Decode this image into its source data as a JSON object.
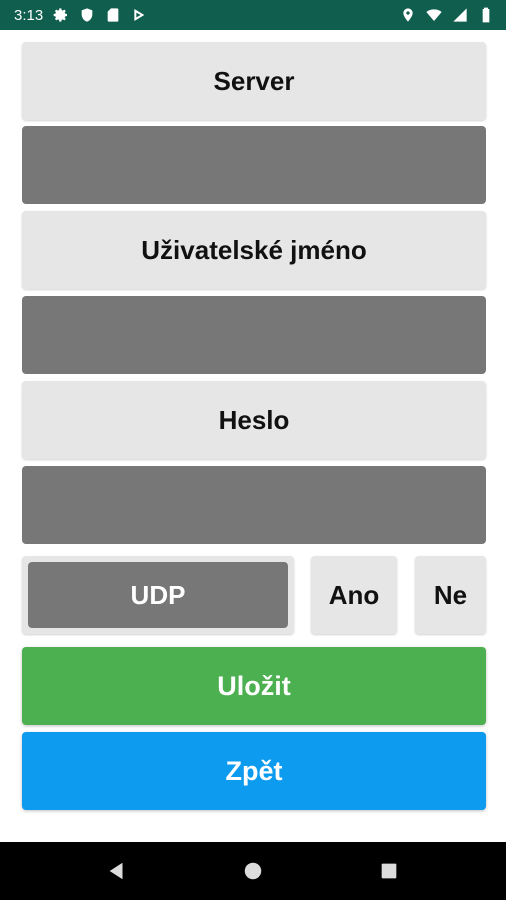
{
  "status_bar": {
    "time": "3:13",
    "left_icons": [
      "settings-icon",
      "shield-icon",
      "sd-card-icon",
      "play-store-icon"
    ],
    "right_icons": [
      "location-icon",
      "wifi-icon",
      "signal-icon",
      "battery-icon"
    ],
    "background_color": "#0f5e4e"
  },
  "form": {
    "server_label": "Server",
    "server_value": "",
    "username_label": "Uživatelské jméno",
    "username_value": "",
    "password_label": "Heslo",
    "password_value": "",
    "protocol_value": "UDP",
    "yes_label": "Ano",
    "no_label": "Ne"
  },
  "actions": {
    "save_label": "Uložit",
    "save_color": "#4caf50",
    "back_label": "Zpět",
    "back_color": "#0d9bf0"
  },
  "nav_bar": {
    "icons": [
      "back-triangle-icon",
      "home-circle-icon",
      "recents-square-icon"
    ]
  }
}
